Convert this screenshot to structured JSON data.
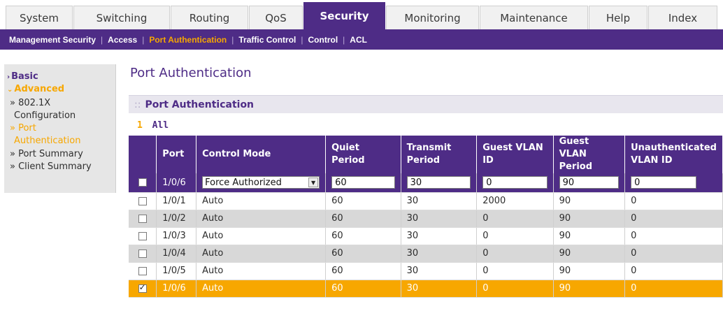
{
  "topnav": {
    "tabs": [
      "System",
      "Switching",
      "Routing",
      "QoS",
      "Security",
      "Monitoring",
      "Maintenance",
      "Help",
      "Index"
    ],
    "active": "Security"
  },
  "subnav": {
    "items": [
      "Management Security",
      "Access",
      "Port Authentication",
      "Traffic Control",
      "Control",
      "ACL"
    ],
    "active": "Port Authentication"
  },
  "sidebar": {
    "basic": "Basic",
    "advanced": "Advanced",
    "items": [
      "» 802.1X",
      "Configuration",
      "» Port",
      "Authentication",
      "» Port Summary",
      "» Client Summary"
    ]
  },
  "page": {
    "title": "Port Authentication",
    "section": "Port Authentication",
    "pager_num": "1",
    "pager_all": "All"
  },
  "table": {
    "headers": [
      "Port",
      "Control Mode",
      "Quiet Period",
      "Transmit Period",
      "Guest VLAN ID",
      "Guest VLAN Period",
      "Unauthenticated VLAN ID"
    ],
    "edit_row": {
      "port": "1/0/6",
      "control_mode": "Force Authorized",
      "quiet": "60",
      "transmit": "30",
      "guest_vlan_id": "0",
      "guest_vlan_period": "90",
      "unauth_vlan_id": "0"
    },
    "rows": [
      {
        "port": "1/0/1",
        "mode": "Auto",
        "quiet": "60",
        "transmit": "30",
        "gvid": "2000",
        "gvp": "90",
        "uvid": "0"
      },
      {
        "port": "1/0/2",
        "mode": "Auto",
        "quiet": "60",
        "transmit": "30",
        "gvid": "0",
        "gvp": "90",
        "uvid": "0"
      },
      {
        "port": "1/0/3",
        "mode": "Auto",
        "quiet": "60",
        "transmit": "30",
        "gvid": "0",
        "gvp": "90",
        "uvid": "0"
      },
      {
        "port": "1/0/4",
        "mode": "Auto",
        "quiet": "60",
        "transmit": "30",
        "gvid": "0",
        "gvp": "90",
        "uvid": "0"
      },
      {
        "port": "1/0/5",
        "mode": "Auto",
        "quiet": "60",
        "transmit": "30",
        "gvid": "0",
        "gvp": "90",
        "uvid": "0"
      },
      {
        "port": "1/0/6",
        "mode": "Auto",
        "quiet": "60",
        "transmit": "30",
        "gvid": "0",
        "gvp": "90",
        "uvid": "0"
      }
    ]
  }
}
